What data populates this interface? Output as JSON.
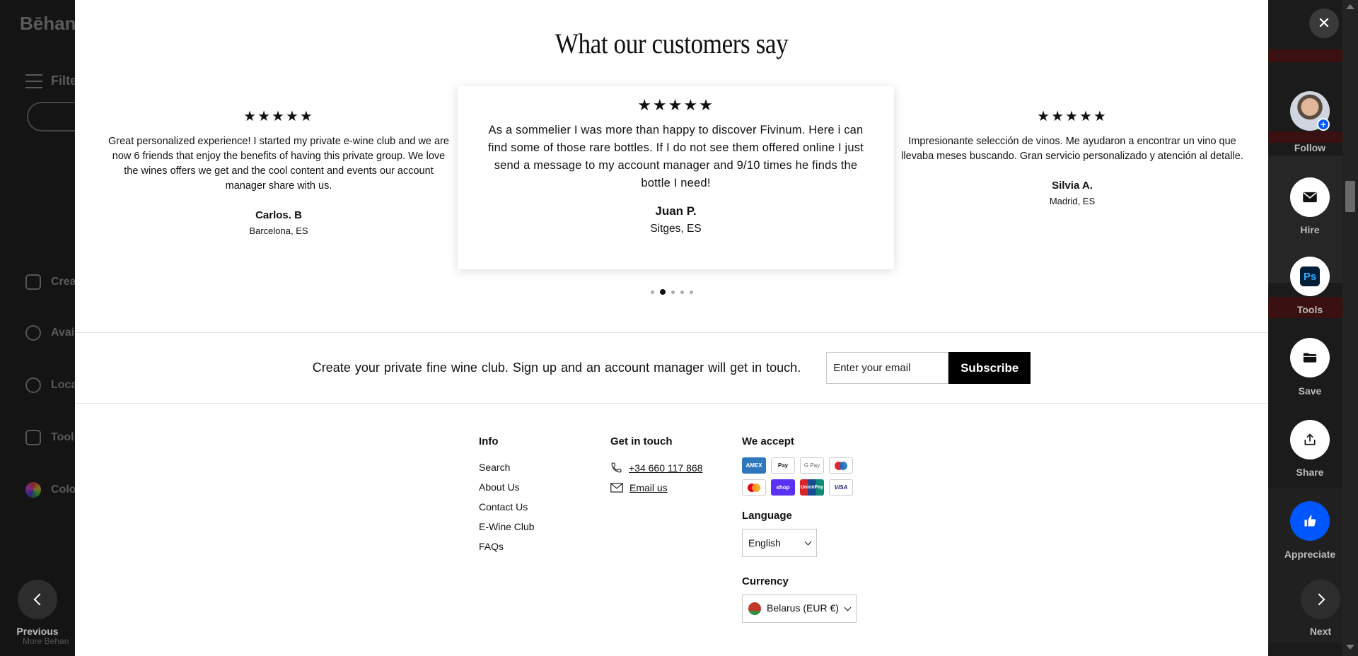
{
  "background": {
    "logo": "Bēhan",
    "filter_label": "Filte",
    "menu": [
      {
        "label": "Crea",
        "icon": "creative-fields-icon"
      },
      {
        "label": "Avai",
        "icon": "availability-icon"
      },
      {
        "label": "Loca",
        "icon": "location-icon"
      },
      {
        "label": "Tool",
        "icon": "tools-icon"
      },
      {
        "label": "Colo",
        "icon": "color-icon"
      }
    ],
    "more_text": "More Behan"
  },
  "testimonials": {
    "title": "What our customers say",
    "reviews": [
      {
        "stars": "★★★★★",
        "text": "Great personalized experience! I started my private e-wine club and we are now 6 friends that enjoy the benefits of having this private group. We love the wines offers we get and the cool content and events our account manager share with us.",
        "name": "Carlos. B",
        "location": "Barcelona, ES"
      },
      {
        "stars": "★★★★★",
        "text": "As a sommelier I was more than happy to discover Fivinum. Here i can find some of those rare bottles. If I do not see them offered online I just send a message to my account manager and 9/10 times he finds the bottle I need!",
        "name": "Juan P.",
        "location": "Sitges, ES"
      },
      {
        "stars": "★★★★★",
        "text": "Impresionante selección de vinos. Me ayudaron a encontrar un vino que llevaba meses buscando. Gran servicio personalizado y atención al detalle.",
        "name": "Silvia A.",
        "location": "Madrid, ES"
      }
    ],
    "dots_count": 5,
    "active_dot": 1
  },
  "newsletter": {
    "message": "Create your private fine wine club.  Sign up and an account manager will get in touch.",
    "email_placeholder": "Enter your email",
    "subscribe_label": "Subscribe"
  },
  "footer": {
    "info": {
      "heading": "Info",
      "links": [
        "Search",
        "About Us",
        "Contact Us",
        "E-Wine Club",
        "FAQs"
      ]
    },
    "contact": {
      "heading": "Get in touch",
      "phone": "+34 660 117 868",
      "email": "Email us"
    },
    "payments": {
      "heading": "We accept",
      "methods": [
        {
          "name": "amex",
          "label": "AMEX",
          "color": "#2e77bc"
        },
        {
          "name": "apple-pay",
          "label": "Pay",
          "color": "#ffffff"
        },
        {
          "name": "google-pay",
          "label": "G Pay",
          "color": "#ffffff"
        },
        {
          "name": "maestro",
          "label": "●●",
          "color": "#ffffff"
        },
        {
          "name": "mastercard",
          "label": "●●",
          "color": "#ffffff"
        },
        {
          "name": "shop-pay",
          "label": "shop",
          "color": "#5a31f4"
        },
        {
          "name": "union-pay",
          "label": "UnionPay",
          "color": "#d9252a"
        },
        {
          "name": "visa",
          "label": "VISA",
          "color": "#ffffff"
        }
      ]
    },
    "language": {
      "label": "Language",
      "selected": "English"
    },
    "currency": {
      "label": "Currency",
      "selected": "Belarus (EUR €)"
    }
  },
  "overlay": {
    "close": "✕",
    "previous_label": "Previous",
    "next_label": "Next",
    "actions": {
      "follow": "Follow",
      "hire": "Hire",
      "tools": "Tools",
      "tools_badge": "Ps",
      "save": "Save",
      "share": "Share",
      "appreciate": "Appreciate"
    },
    "accent_color": "#0057ff"
  }
}
